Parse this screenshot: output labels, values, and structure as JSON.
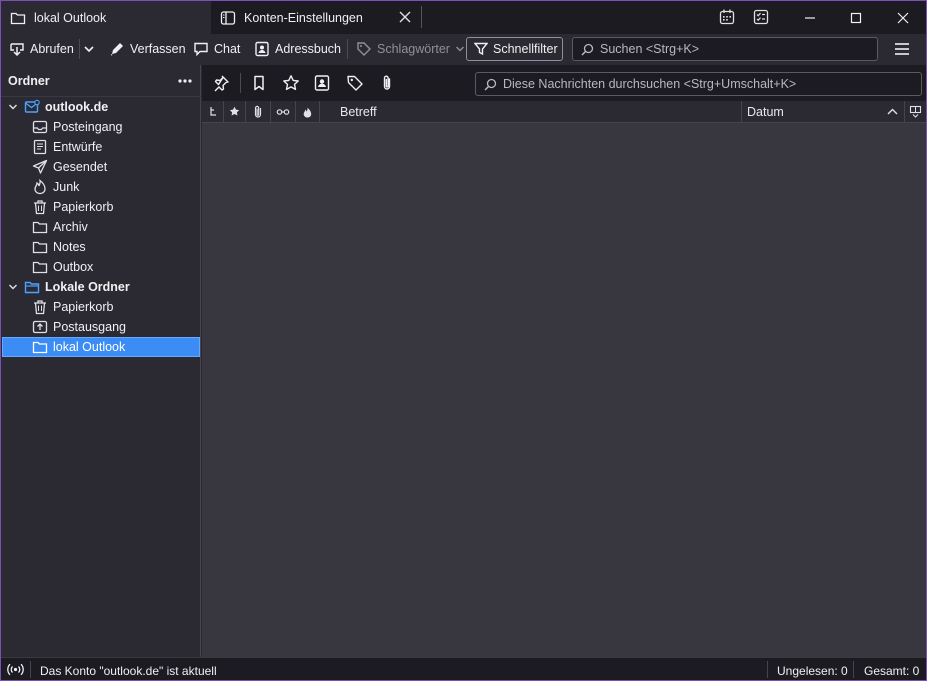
{
  "tabs": [
    {
      "label": "lokal Outlook",
      "icon": "folder-icon",
      "active": true
    },
    {
      "label": "Konten-Einstellungen",
      "icon": "settings-tab-icon",
      "active": false
    }
  ],
  "toolbar": {
    "get_messages": "Abrufen",
    "compose": "Verfassen",
    "chat": "Chat",
    "address_book": "Adressbuch",
    "tags": "Schlagwörter",
    "quick_filter": "Schnellfilter",
    "search_placeholder": "Suchen <Strg+K>"
  },
  "folder_pane": {
    "header": "Ordner",
    "folders": [
      {
        "label": "outlook.de",
        "icon": "mail-account-icon",
        "type": "account"
      },
      {
        "label": "Posteingang",
        "icon": "inbox-icon",
        "type": "folder"
      },
      {
        "label": "Entwürfe",
        "icon": "drafts-icon",
        "type": "folder"
      },
      {
        "label": "Gesendet",
        "icon": "sent-icon",
        "type": "folder"
      },
      {
        "label": "Junk",
        "icon": "junk-icon",
        "type": "folder"
      },
      {
        "label": "Papierkorb",
        "icon": "trash-icon",
        "type": "folder"
      },
      {
        "label": "Archiv",
        "icon": "folder-icon",
        "type": "folder"
      },
      {
        "label": "Notes",
        "icon": "folder-icon",
        "type": "folder"
      },
      {
        "label": "Outbox",
        "icon": "folder-icon",
        "type": "folder"
      },
      {
        "label": "Lokale Ordner",
        "icon": "local-folders-icon",
        "type": "account"
      },
      {
        "label": "Papierkorb",
        "icon": "trash-icon",
        "type": "folder"
      },
      {
        "label": "Postausgang",
        "icon": "outbox-icon",
        "type": "folder"
      },
      {
        "label": "lokal Outlook",
        "icon": "folder-icon",
        "type": "folder",
        "selected": true
      }
    ]
  },
  "message_pane": {
    "search_placeholder": "Diese Nachrichten durchsuchen <Strg+Umschalt+K>",
    "columns": {
      "subject": "Betreff",
      "date": "Datum"
    }
  },
  "statusbar": {
    "message": "Das Konto \"outlook.de\" ist aktuell",
    "unread": "Ungelesen: 0",
    "total": "Gesamt: 0"
  },
  "colors": {
    "accent": "#3b8cf5",
    "window_border": "#7a4fb8",
    "background": "#2b2a33",
    "chrome": "#1c1b22"
  }
}
